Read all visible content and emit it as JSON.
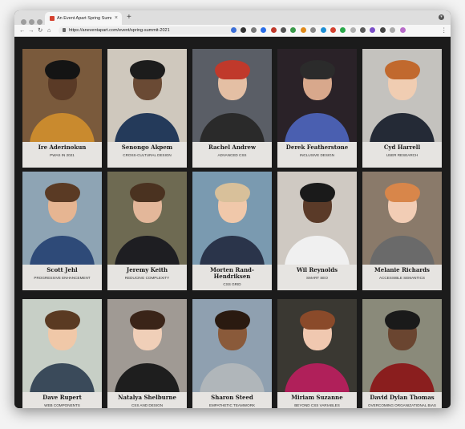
{
  "browser": {
    "tab_title": "An Event Apart Spring Summi",
    "tab_close": "×",
    "new_tab": "+",
    "url": "https://aneventapart.com/event/spring-summit-2021",
    "back": "←",
    "forward": "→",
    "reload": "↻",
    "home": "⌂",
    "menu": "⋮",
    "accent": "#d4412f",
    "extension_icons": [
      "#3c6fd8",
      "#333333",
      "#7a7a7a",
      "#2a6ee8",
      "#c0392b",
      "#555555",
      "#3a9a4a",
      "#e08a1a",
      "#888888",
      "#1e8ed4",
      "#d4412f",
      "#2aa84a",
      "#b0b0b0",
      "#5a5a5a",
      "#7a4fc8",
      "#444444",
      "#aaaaaa",
      "#b86cc9"
    ]
  },
  "speakers": [
    {
      "name": "Ire Aderinokun",
      "topic": "PWAs in 2021"
    },
    {
      "name": "Senongo Akpem",
      "topic": "Cross-Cultural Design"
    },
    {
      "name": "Rachel Andrew",
      "topic": "Advanced CSS"
    },
    {
      "name": "Derek Featherstone",
      "topic": "Inclusive Design"
    },
    {
      "name": "Cyd Harrell",
      "topic": "User Research"
    },
    {
      "name": "Scott Jehl",
      "topic": "Progressive Enhancement"
    },
    {
      "name": "Jeremy Keith",
      "topic": "Reducing Complexity"
    },
    {
      "name": "Morten Rand-Hendriksen",
      "topic": "CSS Grid"
    },
    {
      "name": "Wil Reynolds",
      "topic": "Smart SEO"
    },
    {
      "name": "Melanie Richards",
      "topic": "Accessible Semantics"
    },
    {
      "name": "Dave Rupert",
      "topic": "Web Components"
    },
    {
      "name": "Natalya Shelburne",
      "topic": "CSS and Design"
    },
    {
      "name": "Sharon Steed",
      "topic": "Empathetic Teamwork"
    },
    {
      "name": "Miriam Suzanne",
      "topic": "Beyond CSS Variables"
    },
    {
      "name": "David Dylan Thomas",
      "topic": "Overcoming Organizational Bias"
    }
  ]
}
